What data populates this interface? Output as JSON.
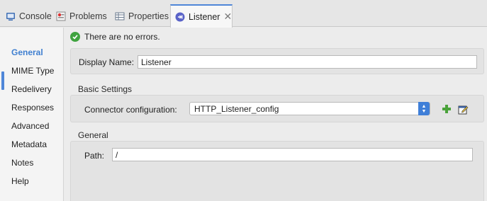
{
  "tabs": [
    {
      "label": "Console",
      "icon": "console-icon"
    },
    {
      "label": "Problems",
      "icon": "problems-icon"
    },
    {
      "label": "Properties",
      "icon": "properties-icon"
    },
    {
      "label": "Listener",
      "icon": "listener-icon",
      "active": true
    }
  ],
  "nav": {
    "items": [
      "General",
      "MIME Type",
      "Redelivery",
      "Responses",
      "Advanced",
      "Metadata",
      "Notes",
      "Help"
    ],
    "active": "General"
  },
  "status": {
    "message": "There are no errors."
  },
  "display_name": {
    "label": "Display Name:",
    "value": "Listener"
  },
  "basic_settings": {
    "title": "Basic Settings",
    "connector_label": "Connector configuration:",
    "connector_value": "HTTP_Listener_config"
  },
  "general": {
    "title": "General",
    "path_label": "Path:",
    "path_value": "/"
  },
  "colors": {
    "accent": "#4f86d8",
    "success": "#3fa33f",
    "add": "#4aa23a"
  }
}
